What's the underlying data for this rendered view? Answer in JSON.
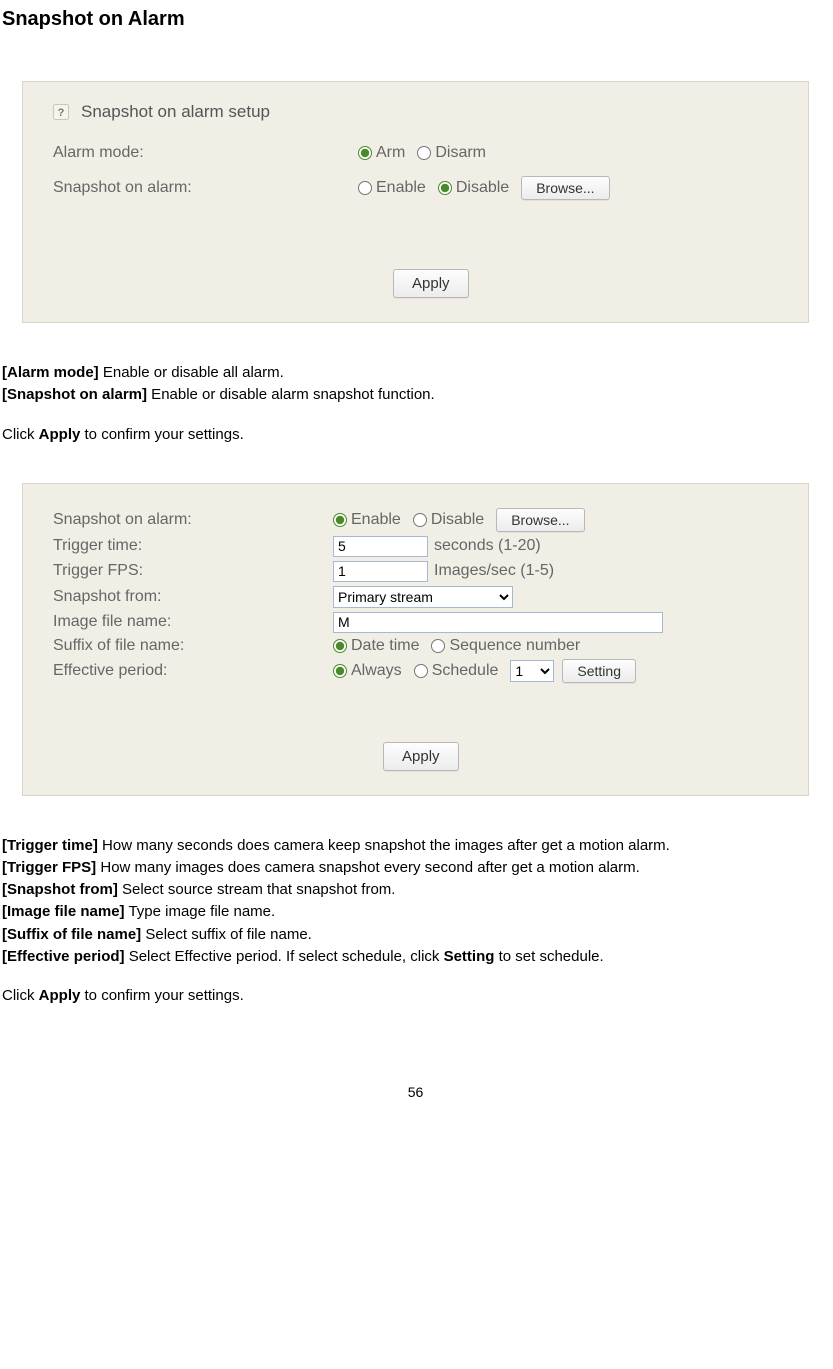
{
  "title": "Snapshot on Alarm",
  "panel1": {
    "header": "Snapshot on alarm setup",
    "rows": {
      "alarm_mode": {
        "label": "Alarm mode:",
        "arm": "Arm",
        "disarm": "Disarm"
      },
      "snapshot_on_alarm": {
        "label": "Snapshot on alarm:",
        "enable": "Enable",
        "disable": "Disable",
        "browse": "Browse..."
      }
    },
    "apply": "Apply"
  },
  "desc1": {
    "alarm_mode_lead": "[Alarm mode]",
    "alarm_mode_body": " Enable or disable all alarm.",
    "snapshot_lead": "[Snapshot on alarm]",
    "snapshot_body": " Enable or disable alarm snapshot function."
  },
  "confirm1_pre": "Click ",
  "confirm1_strong": "Apply",
  "confirm1_post": " to confirm your settings.",
  "panel2": {
    "rows": {
      "snapshot_on_alarm": {
        "label": "Snapshot on alarm:",
        "enable": "Enable",
        "disable": "Disable",
        "browse": "Browse..."
      },
      "trigger_time": {
        "label": "Trigger time:",
        "value": "5",
        "after": "seconds (1-20)"
      },
      "trigger_fps": {
        "label": "Trigger FPS:",
        "value": "1",
        "after": "Images/sec (1-5)"
      },
      "snapshot_from": {
        "label": "Snapshot from:",
        "value": "Primary stream"
      },
      "image_file_name": {
        "label": "Image file name:",
        "value": "M"
      },
      "suffix": {
        "label": "Suffix of file name:",
        "datetime": "Date time",
        "sequence": "Sequence number"
      },
      "effective_period": {
        "label": "Effective period:",
        "always": "Always",
        "schedule": "Schedule",
        "sched_value": "1",
        "setting": "Setting"
      }
    },
    "apply": "Apply"
  },
  "desc2": {
    "trigger_time_lead": "[Trigger time]",
    "trigger_time_body": " How many seconds does camera keep snapshot the images after get a motion alarm.",
    "trigger_fps_lead": "[Trigger FPS]",
    "trigger_fps_body": " How many images does camera snapshot every second after get a motion alarm.",
    "snapshot_from_lead": "[Snapshot from]",
    "snapshot_from_body": " Select source stream that snapshot from.",
    "image_file_name_lead": "[Image file name]",
    "image_file_name_body": " Type image file name.",
    "suffix_lead": "[Suffix of file name]",
    "suffix_body": " Select suffix of file name.",
    "effective_lead": "[Effective period]",
    "effective_body": " Select Effective period. If select schedule, click ",
    "effective_setting": "Setting",
    "effective_tail": " to set schedule."
  },
  "confirm2_pre": "Click ",
  "confirm2_strong": "Apply",
  "confirm2_post": " to confirm your settings.",
  "page_number": "56"
}
